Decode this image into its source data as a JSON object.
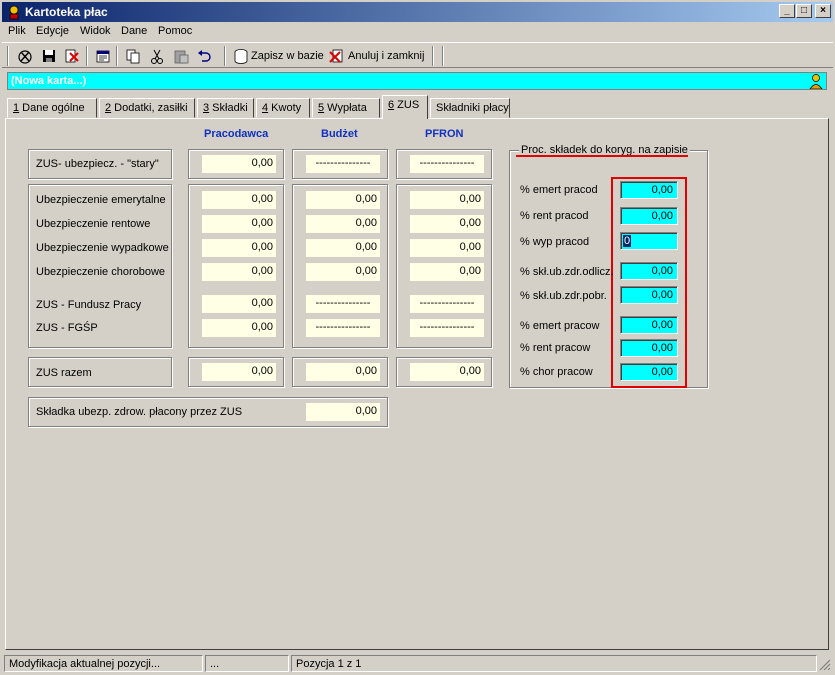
{
  "window": {
    "title": "Kartoteka płac",
    "controls": {
      "minimize": "_",
      "maximize": "□",
      "close": "×"
    }
  },
  "menu": [
    "Plik",
    "Edycje",
    "Widok",
    "Dane",
    "Pomoc"
  ],
  "toolbar": {
    "save_db": "Zapisz w bazie",
    "cancel_close": "Anuluj i zamknij"
  },
  "card": {
    "title": "(Nowa karta...)"
  },
  "tabs": [
    {
      "key": "1",
      "label": " Dane ogólne"
    },
    {
      "key": "2",
      "label": " Dodatki, zasiłki"
    },
    {
      "key": "3",
      "label": " Składki"
    },
    {
      "key": "4",
      "label": " Kwoty"
    },
    {
      "key": "5",
      "label": " Wypłata"
    },
    {
      "key": "6",
      "label": " ZUS"
    },
    {
      "key": "",
      "label": "Składniki płacy"
    }
  ],
  "columns": {
    "employer": "Pracodawca",
    "budget": "Budżet",
    "pfron": "PFRON"
  },
  "zus_old": {
    "label": "ZUS- ubezpiecz. - \"stary\"",
    "employer": "0,00",
    "budget": "---------------",
    "pfron": "---------------"
  },
  "insurance_rows": [
    {
      "label": "Ubezpieczenie emerytalne",
      "employer": "0,00",
      "budget": "0,00",
      "pfron": "0,00"
    },
    {
      "label": "Ubezpieczenie rentowe",
      "employer": "0,00",
      "budget": "0,00",
      "pfron": "0,00"
    },
    {
      "label": "Ubezpieczenie wypadkowe",
      "employer": "0,00",
      "budget": "0,00",
      "pfron": "0,00"
    },
    {
      "label": "Ubezpieczenie chorobowe",
      "employer": "0,00",
      "budget": "0,00",
      "pfron": "0,00"
    },
    {
      "label": "ZUS - Fundusz Pracy",
      "employer": "0,00",
      "budget": "---------------",
      "pfron": "---------------"
    },
    {
      "label": "ZUS - FGŚP",
      "employer": "0,00",
      "budget": "---------------",
      "pfron": "---------------"
    }
  ],
  "zus_total": {
    "label": "ZUS razem",
    "employer": "0,00",
    "budget": "0,00",
    "pfron": "0,00"
  },
  "health": {
    "label": "Składka ubezp. zdrow. płacony przez ZUS",
    "value": "0,00"
  },
  "correction": {
    "title": "Proc. składek do koryg. na zapisie",
    "rows": [
      {
        "label": "% emert pracod",
        "value": "0,00"
      },
      {
        "label": "% rent pracod",
        "value": "0,00"
      },
      {
        "label": "% wyp pracod",
        "value": "0"
      },
      {
        "label": "% skł.ub.zdr.odlicz.",
        "value": "0,00"
      },
      {
        "label": "% skł.ub.zdr.pobr.",
        "value": "0,00"
      },
      {
        "label": "% emert pracow",
        "value": "0,00"
      },
      {
        "label": "% rent pracow",
        "value": "0,00"
      },
      {
        "label": "% chor pracow",
        "value": "0,00"
      }
    ]
  },
  "status": {
    "left": "Modyfikacja aktualnej pozycji...",
    "middle": "...",
    "right": "Pozycja 1 z 1"
  },
  "colors": {
    "accent": "#00ffff",
    "header_blue": "#1030c0",
    "highlight_red": "#e00000",
    "field_bg": "#ffffe6"
  }
}
